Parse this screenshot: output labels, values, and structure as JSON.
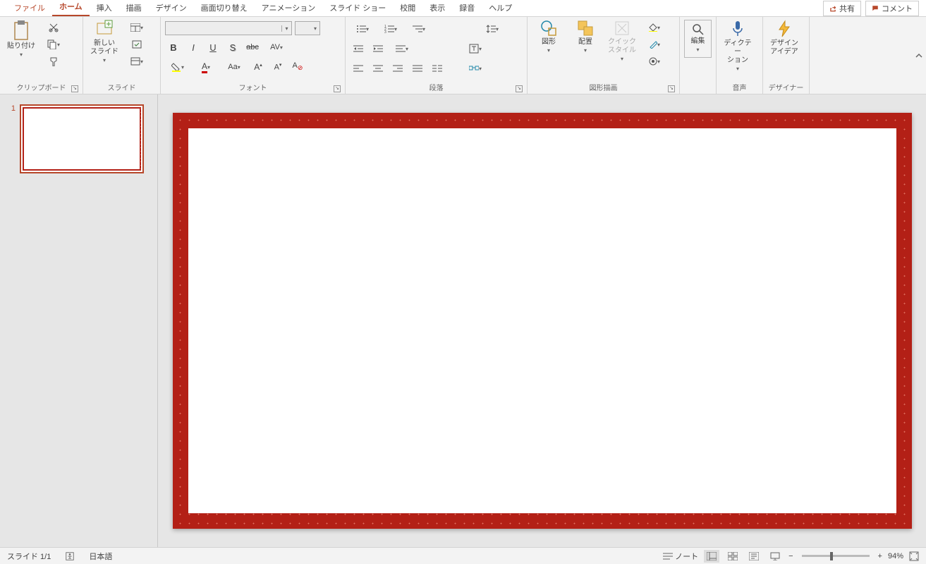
{
  "menu": {
    "file": "ファイル",
    "home": "ホーム",
    "insert": "挿入",
    "draw": "描画",
    "design": "デザイン",
    "transition": "画面切り替え",
    "animation": "アニメーション",
    "slideshow": "スライド ショー",
    "review": "校閲",
    "view": "表示",
    "record": "録音",
    "help": "ヘルプ"
  },
  "share": "共有",
  "comment": "コメント",
  "groups": {
    "clipboard": {
      "label": "クリップボード",
      "paste": "貼り付け"
    },
    "slides": {
      "label": "スライド",
      "new_slide": "新しい\nスライド"
    },
    "font": {
      "label": "フォント"
    },
    "paragraph": {
      "label": "段落"
    },
    "drawing": {
      "label": "図形描画",
      "shapes": "図形",
      "arrange": "配置",
      "quickstyle": "クイック\nスタイル"
    },
    "edit": {
      "label": "編集",
      "find": "編集"
    },
    "voice": {
      "label": "音声",
      "dictate": "ディクテー\nション"
    },
    "designer": {
      "label": "デザイナー",
      "ideas": "デザイン\nアイデア"
    }
  },
  "thumb_num": "1",
  "status": {
    "slide": "スライド 1/1",
    "lang": "日本語",
    "notes": "ノート",
    "zoom": "94%"
  }
}
